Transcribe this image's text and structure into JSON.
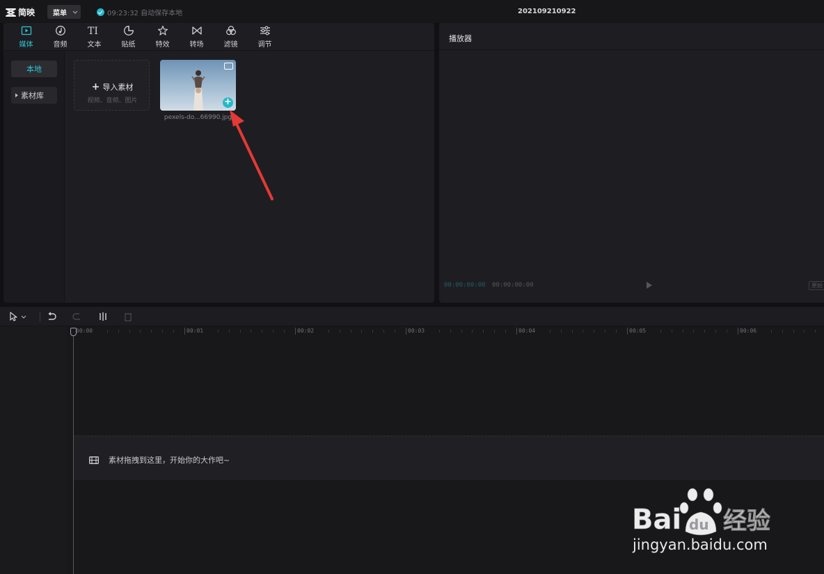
{
  "app": {
    "name": "简映",
    "menu_label": "菜单",
    "save_status": "09:23:32 自动保存本地",
    "project_title": "202109210922"
  },
  "media_tabs": [
    {
      "label": "媒体",
      "icon": "media-icon",
      "active": true
    },
    {
      "label": "音频",
      "icon": "audio-icon",
      "active": false
    },
    {
      "label": "文本",
      "icon": "text-icon",
      "active": false
    },
    {
      "label": "贴纸",
      "icon": "sticker-icon",
      "active": false
    },
    {
      "label": "特效",
      "icon": "effects-icon",
      "active": false
    },
    {
      "label": "转场",
      "icon": "transition-icon",
      "active": false
    },
    {
      "label": "滤镜",
      "icon": "filter-icon",
      "active": false
    },
    {
      "label": "调节",
      "icon": "adjust-icon",
      "active": false
    }
  ],
  "sidebar": {
    "local": "本地",
    "library": "素材库"
  },
  "import_card": {
    "label": "导入素材",
    "sub_label": "视频、音频、图片"
  },
  "asset": {
    "filename": "pexels-do...66990.jpg"
  },
  "player": {
    "title": "播放器",
    "time_current": "00:00:00:00",
    "time_total": "00:00:00:00",
    "ratio_label": "原始"
  },
  "timeline": {
    "ruler_labels": [
      "00:00",
      "00:01",
      "00:02",
      "00:03",
      "00:04",
      "00:05",
      "00:06"
    ],
    "drop_hint": "素材拖拽到这里，开始你的大作吧~"
  },
  "watermark": {
    "logo_text": "Bai",
    "logo_text2": "du",
    "logo_cn": "经验",
    "url": "jingyan.baidu.com"
  },
  "colors": {
    "accent": "#2ec5d3",
    "background": "#111114",
    "panel": "#1e1e22",
    "arrow": "#e53935"
  }
}
